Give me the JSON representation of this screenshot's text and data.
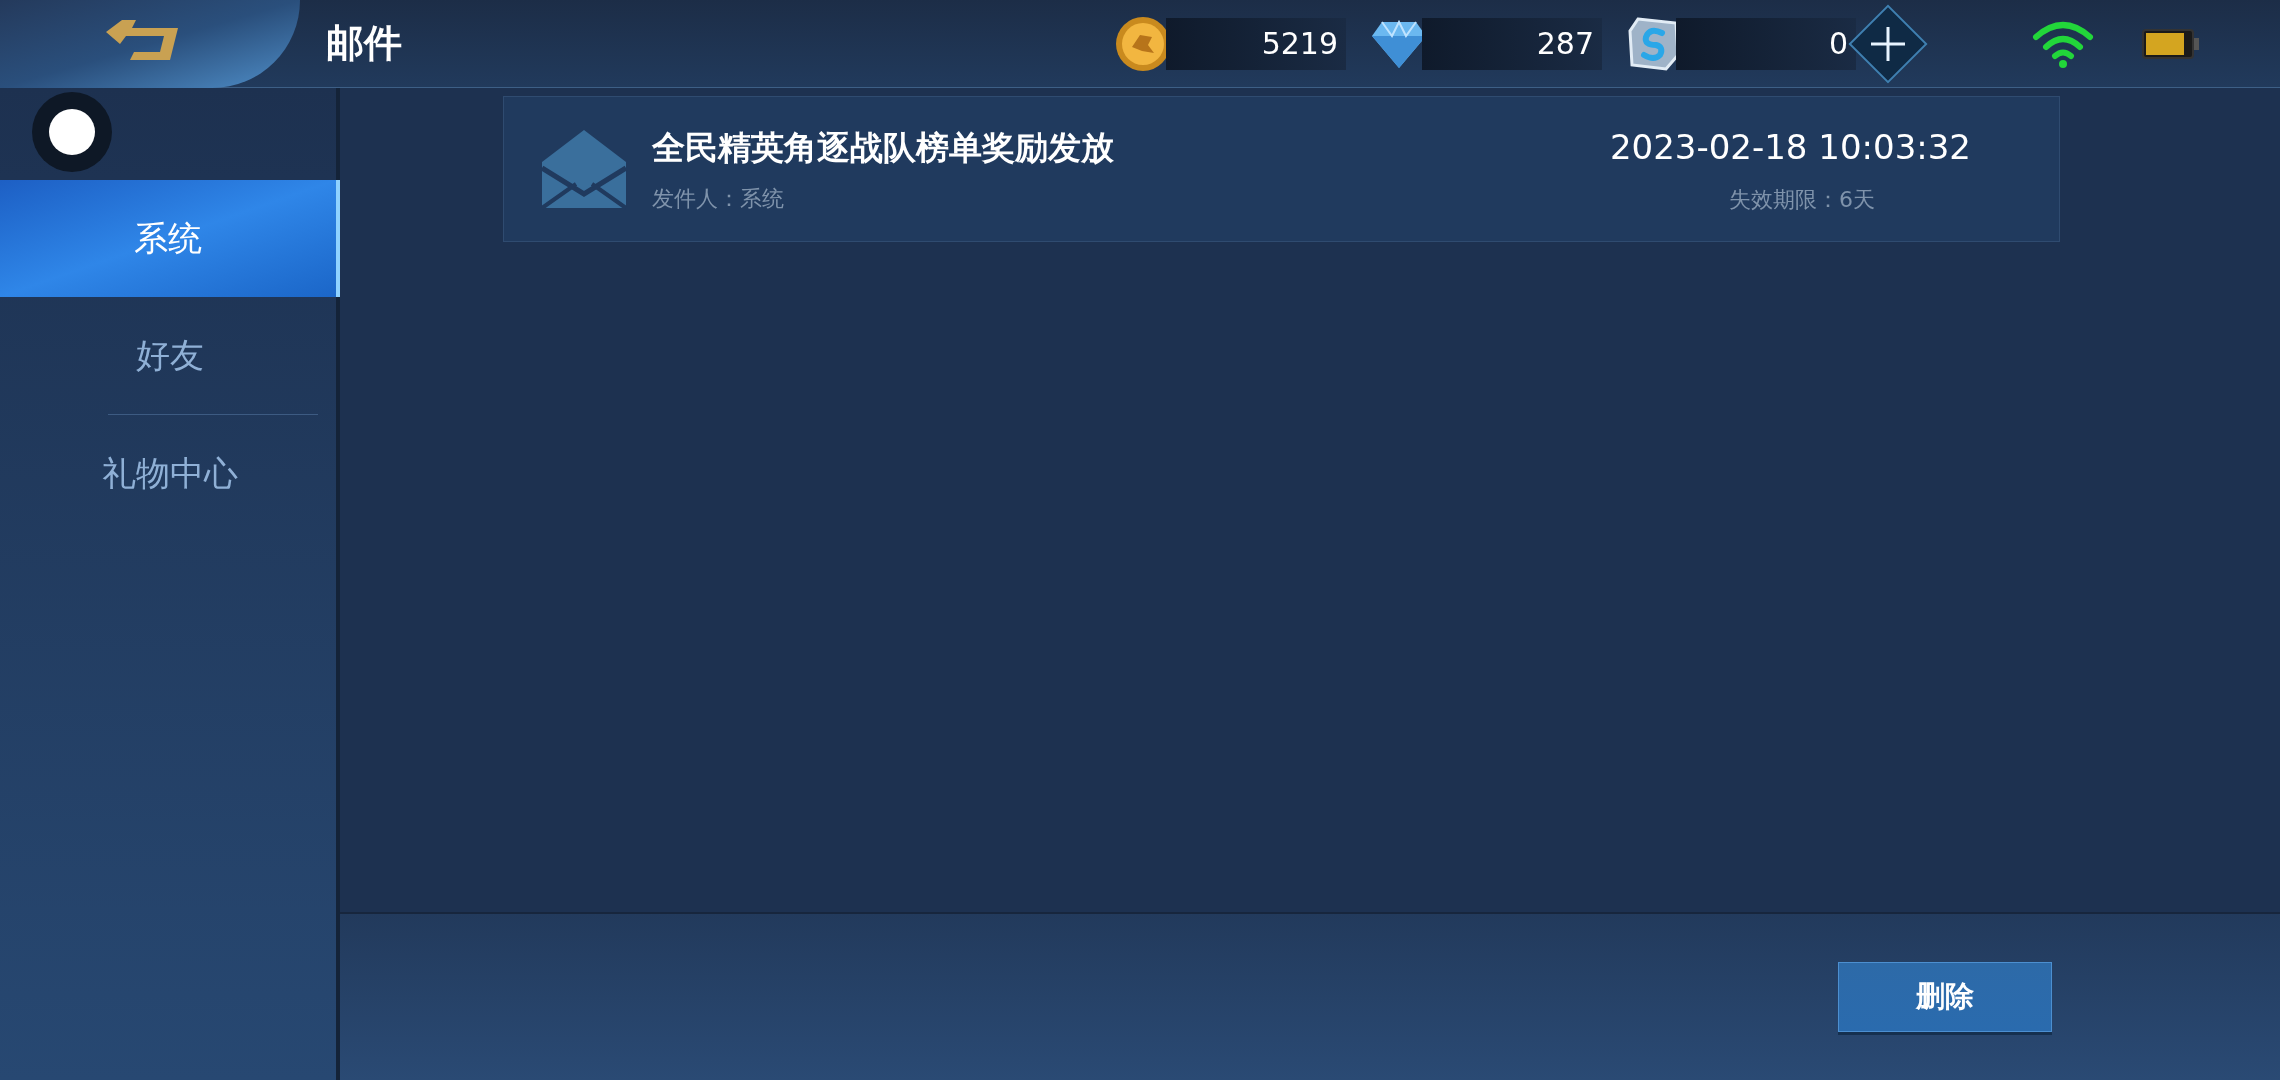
{
  "header": {
    "title": "邮件"
  },
  "currencies": [
    {
      "kind": "coin",
      "value": "5219"
    },
    {
      "kind": "diamond",
      "value": "287"
    },
    {
      "kind": "token",
      "value": "0"
    }
  ],
  "sidebar": {
    "tabs": [
      {
        "label": "系统",
        "selected": true
      },
      {
        "label": "好友",
        "selected": false
      },
      {
        "label": "礼物中心",
        "selected": false
      }
    ]
  },
  "mails": [
    {
      "title": "全民精英角逐战队榜单奖励发放",
      "sender": "发件人：系统",
      "time": "2023-02-18 10:03:32",
      "expiry": "失效期限：6天"
    }
  ],
  "delete_button": "删除"
}
